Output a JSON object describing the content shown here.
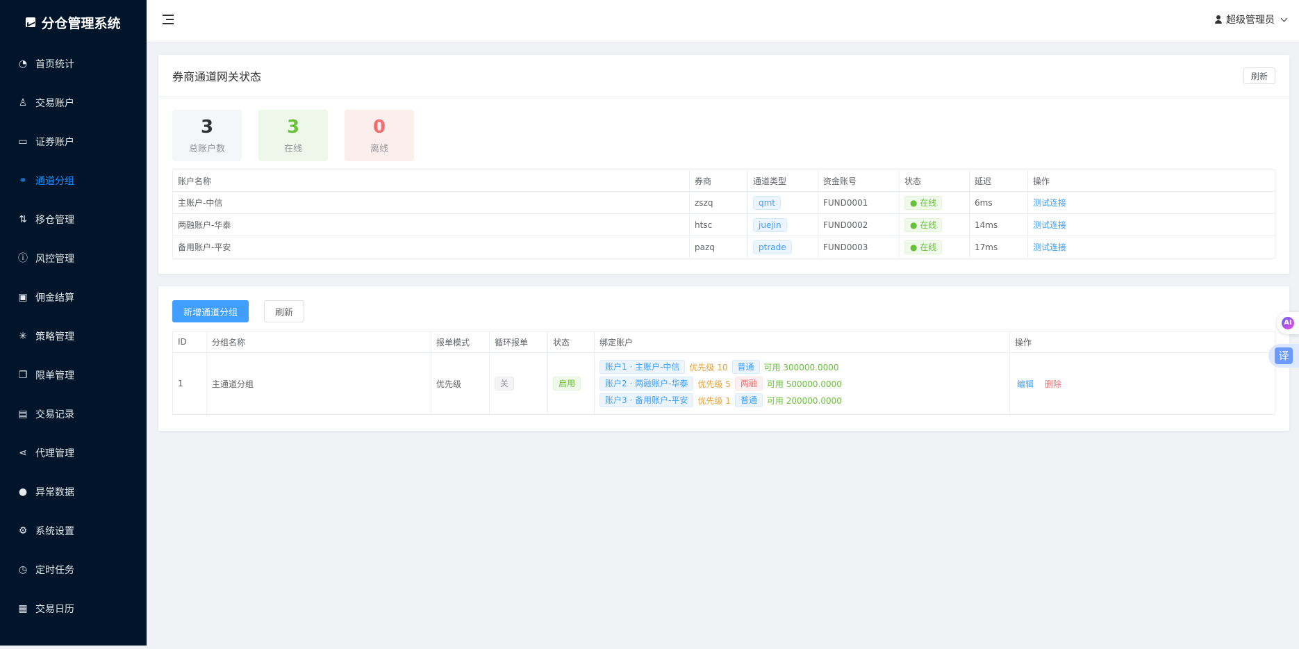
{
  "app": {
    "title": "分仓管理系统"
  },
  "sidebar": {
    "items": [
      {
        "label": "首页统计",
        "icon": "dashboard-icon",
        "glyph": "◔"
      },
      {
        "label": "交易账户",
        "icon": "user-icon",
        "glyph": "♙"
      },
      {
        "label": "证券账户",
        "icon": "wallet-icon",
        "glyph": "▭"
      },
      {
        "label": "通道分组",
        "icon": "link-icon",
        "glyph": "⚭"
      },
      {
        "label": "移仓管理",
        "icon": "sort-icon",
        "glyph": "⇅"
      },
      {
        "label": "风控管理",
        "icon": "warning-icon",
        "glyph": "ⓘ"
      },
      {
        "label": "佣金结算",
        "icon": "money-icon",
        "glyph": "▣"
      },
      {
        "label": "策略管理",
        "icon": "loading-icon",
        "glyph": "✳"
      },
      {
        "label": "限单管理",
        "icon": "copy-icon",
        "glyph": "❐"
      },
      {
        "label": "交易记录",
        "icon": "clipboard-icon",
        "glyph": "▤"
      },
      {
        "label": "代理管理",
        "icon": "share-icon",
        "glyph": "⋖"
      },
      {
        "label": "异常数据",
        "icon": "alert-icon",
        "glyph": "●"
      },
      {
        "label": "系统设置",
        "icon": "gear-icon",
        "glyph": "⚙"
      },
      {
        "label": "定时任务",
        "icon": "timer-icon",
        "glyph": "◷"
      },
      {
        "label": "交易日历",
        "icon": "calendar-icon",
        "glyph": "▦"
      }
    ],
    "active_index": 3
  },
  "header": {
    "user": "超级管理员"
  },
  "gateway": {
    "title": "券商通道网关状态",
    "refresh": "刷新",
    "stats": {
      "total": {
        "value": "3",
        "label": "总账户数"
      },
      "online": {
        "value": "3",
        "label": "在线"
      },
      "offline": {
        "value": "0",
        "label": "离线"
      }
    },
    "columns": [
      "账户名称",
      "券商",
      "通道类型",
      "资金账号",
      "状态",
      "延迟",
      "操作"
    ],
    "rows": [
      {
        "name": "主账户-中信",
        "broker": "zszq",
        "channel": "qmt",
        "fund": "FUND0001",
        "status": "● 在线",
        "latency": "6ms",
        "action": "测试连接"
      },
      {
        "name": "两融账户-华泰",
        "broker": "htsc",
        "channel": "juejin",
        "fund": "FUND0002",
        "status": "● 在线",
        "latency": "14ms",
        "action": "测试连接"
      },
      {
        "name": "备用账户-平安",
        "broker": "pazq",
        "channel": "ptrade",
        "fund": "FUND0003",
        "status": "● 在线",
        "latency": "17ms",
        "action": "测试连接"
      }
    ]
  },
  "groups": {
    "add_button": "新增通道分组",
    "refresh": "刷新",
    "columns": [
      "ID",
      "分组名称",
      "报单模式",
      "循环报单",
      "状态",
      "绑定账户",
      "操作"
    ],
    "rows": [
      {
        "id": "1",
        "name": "主通道分组",
        "mode": "优先级",
        "cycle": "关",
        "status": "启用",
        "bindings": [
          {
            "account": "账户1 · 主账户-中信",
            "priority": "优先级 10",
            "type": "普通",
            "type_color": "blue",
            "available": "可用 300000.0000"
          },
          {
            "account": "账户2 · 两融账户-华泰",
            "priority": "优先级 5",
            "type": "两融",
            "type_color": "red",
            "available": "可用 500000.0000"
          },
          {
            "account": "账户3 · 备用账户-平安",
            "priority": "优先级 1",
            "type": "普通",
            "type_color": "blue",
            "available": "可用 200000.0000"
          }
        ],
        "edit": "编辑",
        "delete": "删除"
      }
    ]
  },
  "floating": {
    "translate": "译",
    "assistant": "AI"
  },
  "colors": {
    "sidebar_bg": "#001529",
    "accent": "#409eff",
    "success": "#67c23a",
    "danger": "#f56c6c",
    "warning": "#e6a23c"
  }
}
